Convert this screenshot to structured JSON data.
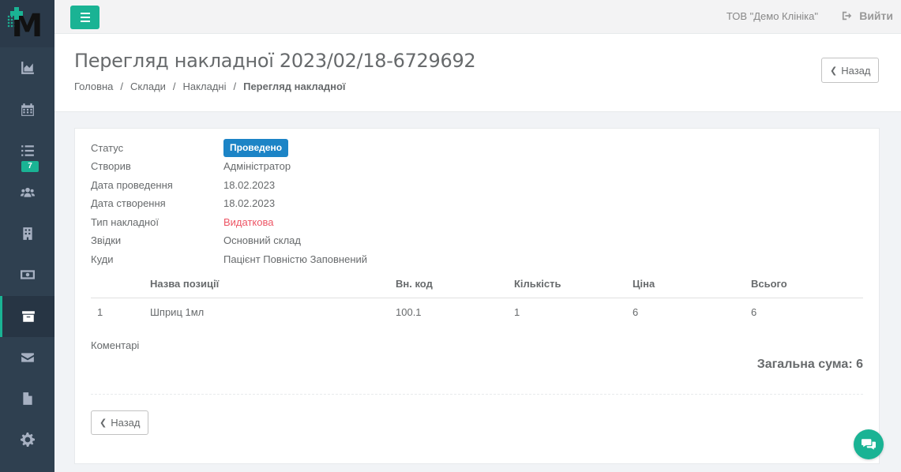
{
  "topbar": {
    "company": "ТОВ \"Демо Клініка\"",
    "logout_label": "Вийти"
  },
  "sidebar": {
    "items": [
      {
        "icon": "chart-area-icon"
      },
      {
        "icon": "calendar-icon"
      },
      {
        "icon": "list-icon",
        "badge": "7"
      },
      {
        "icon": "users-icon"
      },
      {
        "icon": "building-icon"
      },
      {
        "icon": "money-icon"
      },
      {
        "icon": "archive-icon",
        "active": true
      },
      {
        "icon": "envelope-icon"
      },
      {
        "icon": "file-icon"
      },
      {
        "icon": "gear-icon"
      }
    ]
  },
  "heading": {
    "title": "Перегляд накладної 2023/02/18-6729692",
    "breadcrumb": [
      "Головна",
      "Склади",
      "Накладні",
      "Перегляд накладної"
    ],
    "back_label": "Назад"
  },
  "invoice": {
    "labels": {
      "status": "Статус",
      "created_by": "Створив",
      "posted_date": "Дата проведення",
      "created_date": "Дата створення",
      "type": "Тип накладної",
      "from": "Звідки",
      "to": "Куди"
    },
    "values": {
      "status": "Проведено",
      "created_by": "Адміністратор",
      "posted_date": "18.02.2023",
      "created_date": "18.02.2023",
      "type": "Видаткова",
      "from": "Основний склад",
      "to": "Пацієнт Повністю Заповнений"
    },
    "columns": [
      "Назва позиції",
      "Вн. код",
      "Кількість",
      "Ціна",
      "Всього"
    ],
    "rows": [
      {
        "index": "1",
        "name": "Шприц 1мл",
        "code": "100.1",
        "qty": "1",
        "price": "6",
        "total": "6"
      }
    ],
    "comments_label": "Коментарі",
    "grand_total": "Загальна сума: 6",
    "back_label": "Назад"
  },
  "colors": {
    "accent": "#1ab394",
    "status_badge": "#1c84c6",
    "sidebar_bg": "#2f4050",
    "type_red": "#ed5565"
  }
}
